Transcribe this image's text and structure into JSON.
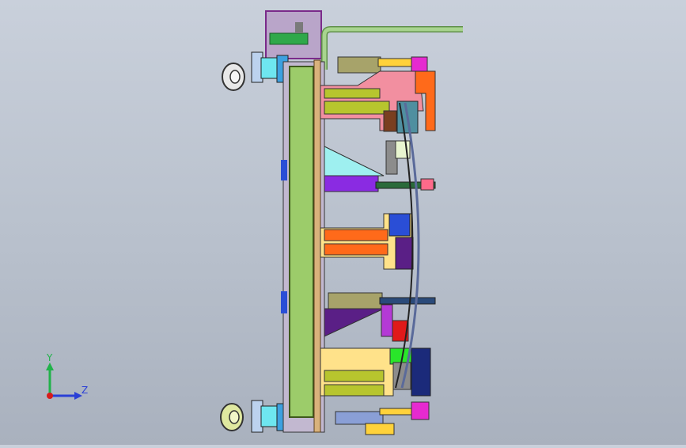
{
  "viewport": {
    "background_top": "#c9d0db",
    "background_bottom": "#a9b1be"
  },
  "model": {
    "colors": {
      "frame_green": "#9ccc6a",
      "frame_edge": "#3e5a1c",
      "base_wood": "#d9b27c",
      "pipe_green": "#8fbf7a",
      "pink": "#f28fa0",
      "olive": "#b7c52e",
      "orange": "#ff6a1a",
      "cyan": "#9ef0f0",
      "purple": "#8a2be2",
      "dark_purple": "#5a1f86",
      "yellow": "#ffe28a",
      "lime": "#29e62a",
      "magenta": "#e62ad0",
      "blue": "#2a4ed6",
      "navy": "#1b2a7a",
      "red": "#e01a1a",
      "gray": "#8c8c8c",
      "dark_red": "#8a2a1a",
      "brown": "#7a3f20"
    }
  },
  "triad": {
    "y_label": "Y",
    "z_label": "Z",
    "y_color": "#21b24a",
    "z_color": "#2a3fd6",
    "origin_color": "#d81b1b"
  }
}
